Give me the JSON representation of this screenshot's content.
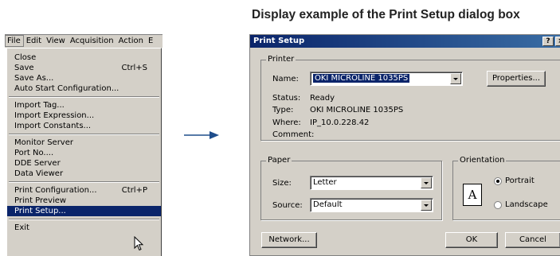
{
  "menu": {
    "bar": [
      "File",
      "Edit",
      "View",
      "Acquisition",
      "Action",
      "E"
    ],
    "groups": [
      [
        {
          "label": "Close",
          "shortcut": ""
        },
        {
          "label": "Save",
          "shortcut": "Ctrl+S"
        },
        {
          "label": "Save As...",
          "shortcut": ""
        },
        {
          "label": "Auto Start Configuration...",
          "shortcut": ""
        }
      ],
      [
        {
          "label": "Import Tag...",
          "shortcut": ""
        },
        {
          "label": "Import Expression...",
          "shortcut": ""
        },
        {
          "label": "Import Constants...",
          "shortcut": ""
        }
      ],
      [
        {
          "label": "Monitor Server",
          "shortcut": ""
        },
        {
          "label": "Port No....",
          "shortcut": ""
        },
        {
          "label": "DDE Server",
          "shortcut": ""
        },
        {
          "label": "Data Viewer",
          "shortcut": ""
        }
      ],
      [
        {
          "label": "Print Configuration...",
          "shortcut": "Ctrl+P"
        },
        {
          "label": "Print Preview",
          "shortcut": ""
        },
        {
          "label": "Print Setup...",
          "shortcut": "",
          "selected": true
        }
      ],
      [
        {
          "label": "Exit",
          "shortcut": ""
        }
      ]
    ]
  },
  "caption": "Display example of the Print Setup dialog box",
  "dialog": {
    "title": "Print Setup",
    "help_label": "?",
    "close_label": "×",
    "printer": {
      "group_label": "Printer",
      "name_label": "Name:",
      "name_value": "OKI MICROLINE 1035PS",
      "properties_label": "Properties...",
      "status_label": "Status:",
      "status_value": "Ready",
      "type_label": "Type:",
      "type_value": "OKI MICROLINE 1035PS",
      "where_label": "Where:",
      "where_value": "IP_10.0.228.42",
      "comment_label": "Comment:",
      "comment_value": ""
    },
    "paper": {
      "group_label": "Paper",
      "size_label": "Size:",
      "size_value": "Letter",
      "source_label": "Source:",
      "source_value": "Default"
    },
    "orientation": {
      "group_label": "Orientation",
      "portrait_label": "Portrait",
      "landscape_label": "Landscape",
      "selected": "Portrait",
      "page_letter": "A"
    },
    "buttons": {
      "network": "Network...",
      "ok": "OK",
      "cancel": "Cancel"
    }
  },
  "colors": {
    "face": "#d4d0c8",
    "selection": "#0a246a",
    "arrow": "#1f4e8c"
  }
}
